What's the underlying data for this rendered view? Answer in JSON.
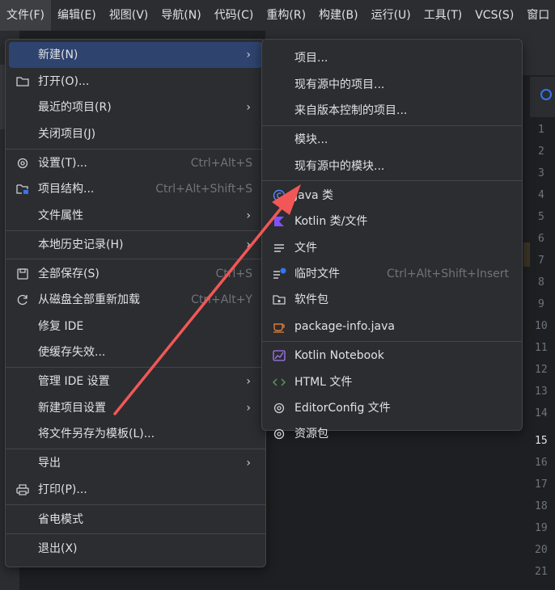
{
  "menubar": [
    {
      "label": "文件(F)"
    },
    {
      "label": "编辑(E)"
    },
    {
      "label": "视图(V)"
    },
    {
      "label": "导航(N)"
    },
    {
      "label": "代码(C)"
    },
    {
      "label": "重构(R)"
    },
    {
      "label": "构建(B)"
    },
    {
      "label": "运行(U)"
    },
    {
      "label": "工具(T)"
    },
    {
      "label": "VCS(S)"
    },
    {
      "label": "窗口"
    }
  ],
  "file_menu": {
    "new": "新建(N)",
    "open": "打开(O)...",
    "recent": "最近的项目(R)",
    "close_project": "关闭项目(J)",
    "settings": "设置(T)...",
    "settings_sc": "Ctrl+Alt+S",
    "project_structure": "项目结构...",
    "project_structure_sc": "Ctrl+Alt+Shift+S",
    "file_properties": "文件属性",
    "local_history": "本地历史记录(H)",
    "save_all": "全部保存(S)",
    "save_all_sc": "Ctrl+S",
    "reload_all": "从磁盘全部重新加载",
    "reload_all_sc": "Ctrl+Alt+Y",
    "repair_ide": "修复 IDE",
    "invalidate_caches": "使缓存失效...",
    "manage_ide_settings": "管理 IDE 设置",
    "new_project_settings": "新建项目设置",
    "save_as_template": "将文件另存为模板(L)...",
    "export": "导出",
    "print": "打印(P)...",
    "power_save": "省电模式",
    "exit": "退出(X)"
  },
  "new_submenu": {
    "project": "项目...",
    "project_from_existing": "现有源中的项目...",
    "project_from_vcs": "来自版本控制的项目...",
    "module": "模块...",
    "module_from_existing": "现有源中的模块...",
    "java_class": "Java 类",
    "kotlin_class": "Kotlin 类/文件",
    "file": "文件",
    "scratch_file": "临时文件",
    "scratch_file_sc": "Ctrl+Alt+Shift+Insert",
    "package": "软件包",
    "package_info": "package-info.java",
    "kotlin_notebook": "Kotlin Notebook",
    "html_file": "HTML 文件",
    "editorconfig": "EditorConfig 文件",
    "resource_bundle": "资源包"
  },
  "gutter_lines": [
    "1",
    "2",
    "3",
    "4",
    "5",
    "6",
    "7",
    "8",
    "9",
    "10",
    "11",
    "12",
    "13",
    "14",
    "15",
    "16",
    "17",
    "18",
    "19",
    "20",
    "21"
  ],
  "colors": {
    "accent": "#3574f0",
    "selection": "#2e436e",
    "annotation_arrow": "#f25757"
  }
}
